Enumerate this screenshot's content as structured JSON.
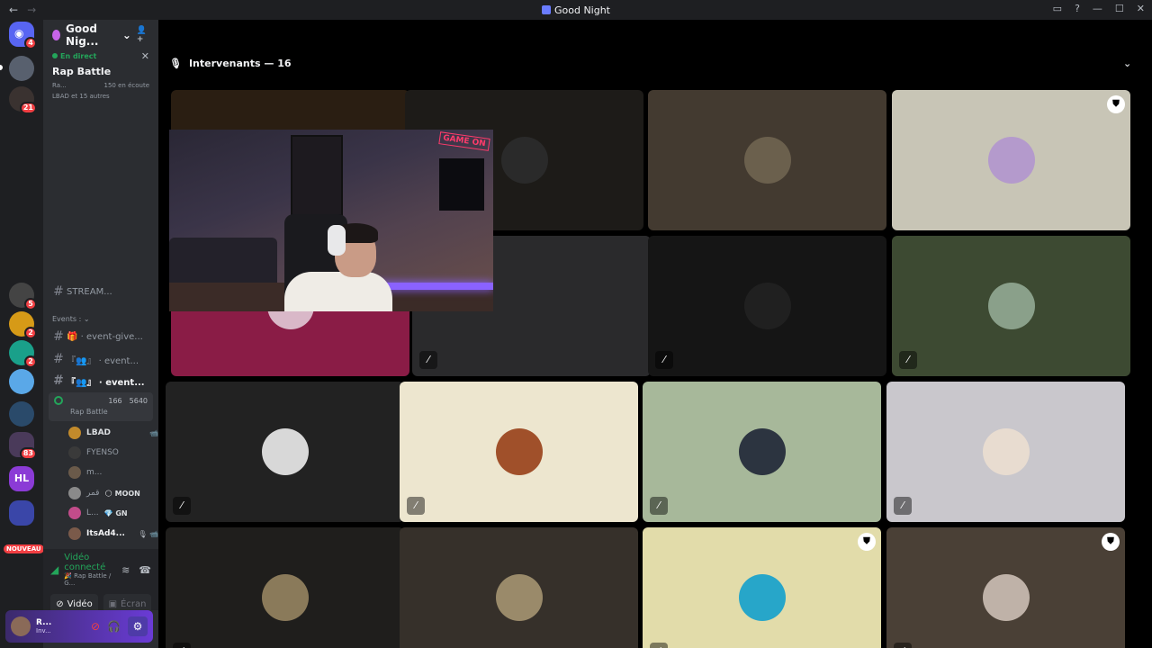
{
  "window": {
    "title": "Good Night",
    "nav_back": "←",
    "nav_forward": "→"
  },
  "rail": {
    "badges": [
      "4",
      "21",
      "5",
      "2",
      "2",
      "83"
    ],
    "nouveau_label": "NOUVEAU",
    "hl_label": "HL"
  },
  "guild": {
    "name": "Good Nig...",
    "chevron": "⌄",
    "invite_icon": "👤+"
  },
  "live": {
    "label": "En direct",
    "title": "Rap Battle",
    "channel_short": "Ra...",
    "listeners": "150 en écoute",
    "hosts": "LBAD et 15 autres",
    "close": "✕"
  },
  "channels": [
    {
      "prefix": "#",
      "label": "STREAM..."
    },
    {
      "prefix": "#",
      "label": "🎁 · event-give..."
    },
    {
      "prefix": "#",
      "label": "『👥』 · event..."
    },
    {
      "prefix": "#",
      "label": "『👥』 · event..."
    }
  ],
  "category": "Events : ⌄",
  "voice_channel": {
    "name": "Rap Battle",
    "cam_count": "166",
    "listener_count": "5640"
  },
  "members": [
    {
      "name": "LBAD",
      "tag": "",
      "color": "#c28a2b",
      "mic": "📹"
    },
    {
      "name": "FYENSO",
      "tag": "",
      "color": "#3a3a3a",
      "mic": ""
    },
    {
      "name": "m...",
      "tag": "",
      "color": "#6a5a4a",
      "mic": ""
    },
    {
      "name": "قمر",
      "tag": "🌕 MOON",
      "color": "#8a8a8a",
      "mic": ""
    },
    {
      "name": "L...",
      "tag": "💎 GN",
      "color": "#c24c8a",
      "mic": ""
    },
    {
      "name": "ItsAd4...",
      "tag": "",
      "color": "#7a5a4a",
      "mic": "🎙 📹"
    }
  ],
  "voice_status": {
    "connected": "Vidéo connecté",
    "location": "🎉 Rap Battle / G...",
    "video_btn": "Vidéo",
    "screen_btn": "Écran"
  },
  "user": {
    "name": "R...",
    "status": "Inv..."
  },
  "stage": {
    "header": "Intervenants — 16"
  },
  "tiles": [
    {
      "name": "tile-stream",
      "bg": "#2a1e12",
      "avatar": "",
      "mute": false,
      "mod": false
    },
    {
      "name": "tile-2",
      "bg": "#1d1b18",
      "avatar": "#2a2a2a",
      "mute": false,
      "mod": false
    },
    {
      "name": "tile-3",
      "bg": "#433a30",
      "avatar": "#6b604d",
      "mute": false,
      "mod": false
    },
    {
      "name": "tile-4",
      "bg": "#c8c5b6",
      "avatar": "#b49acc",
      "mute": false,
      "mod": true
    },
    {
      "name": "tile-5",
      "bg": "#8a1c46",
      "avatar": "#d9b8c8",
      "mute": false,
      "mod": true
    },
    {
      "name": "tile-6",
      "bg": "#2a2a2c",
      "avatar": "",
      "mute": true,
      "mod": false
    },
    {
      "name": "tile-7",
      "bg": "#151515",
      "avatar": "#202020",
      "mute": true,
      "mod": false
    },
    {
      "name": "tile-8",
      "bg": "#3d4a32",
      "avatar": "#8aa08a",
      "mute": true,
      "mod": false
    },
    {
      "name": "tile-9",
      "bg": "#222222",
      "avatar": "#d8d8d8",
      "mute": true,
      "mod": false
    },
    {
      "name": "tile-10",
      "bg": "#ede6cf",
      "avatar": "#a0502a",
      "mute": true,
      "mod": false
    },
    {
      "name": "tile-11",
      "bg": "#a7b89a",
      "avatar": "#2c3440",
      "mute": true,
      "mod": false
    },
    {
      "name": "tile-12",
      "bg": "#c9c7cc",
      "avatar": "#e8dcd0",
      "mute": true,
      "mod": false
    },
    {
      "name": "tile-13",
      "bg": "#1f1e1c",
      "avatar": "#8a7a5a",
      "mute": true,
      "mod": false
    },
    {
      "name": "tile-14",
      "bg": "#36302a",
      "avatar": "#9a8a6a",
      "mute": false,
      "mod": false
    },
    {
      "name": "tile-15",
      "bg": "#e2dcaa",
      "avatar": "#27a6c9",
      "mute": true,
      "mod": true
    },
    {
      "name": "tile-16",
      "bg": "#4a4036",
      "avatar": "#bfb2a8",
      "mute": true,
      "mod": true
    }
  ],
  "icons": {
    "mute": "🎙",
    "mod": "⛊",
    "chevron_down": "⌄",
    "mic": "🎙"
  }
}
